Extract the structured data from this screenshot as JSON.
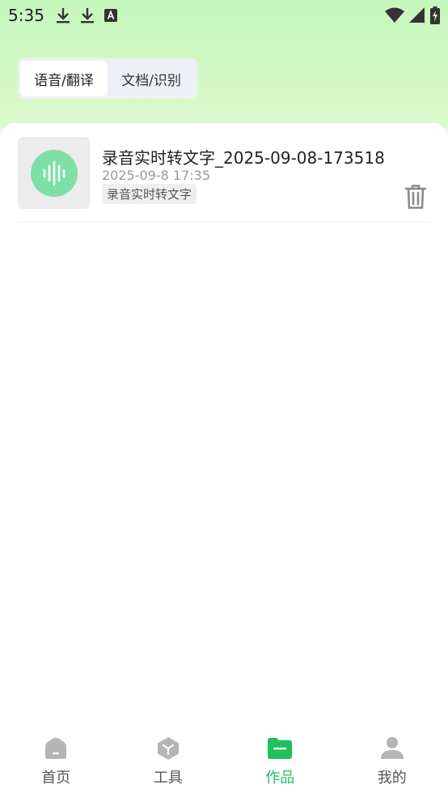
{
  "status_bar": {
    "time": "5:35",
    "left_icons": [
      "download-icon",
      "download-icon",
      "font-a-icon"
    ],
    "right_icons": [
      "wifi-icon",
      "cell-signal-icon",
      "battery-charging-icon"
    ]
  },
  "segmented_control": {
    "tabs": [
      {
        "label": "语音/翻译",
        "active": true
      },
      {
        "label": "文档/识别",
        "active": false
      }
    ]
  },
  "works_list": {
    "items": [
      {
        "thumb_icon": "audio-wave-icon",
        "title": "录音实时转文字_2025-09-08-173518",
        "date": "2025-09-8 17:35",
        "tag": "录音实时转文字",
        "action_icon": "trash-icon"
      }
    ]
  },
  "bottom_nav": {
    "items": [
      {
        "label": "首页",
        "icon": "home-icon",
        "active": false
      },
      {
        "label": "工具",
        "icon": "tools-icon",
        "active": false
      },
      {
        "label": "作品",
        "icon": "folder-icon",
        "active": true
      },
      {
        "label": "我的",
        "icon": "user-icon",
        "active": false
      }
    ]
  },
  "colors": {
    "accent": "#20c05c",
    "header_gradient_top": "#c6f7bc",
    "thumb_circle": "#7ee0a6",
    "inactive_icon": "#b5b5b5"
  }
}
